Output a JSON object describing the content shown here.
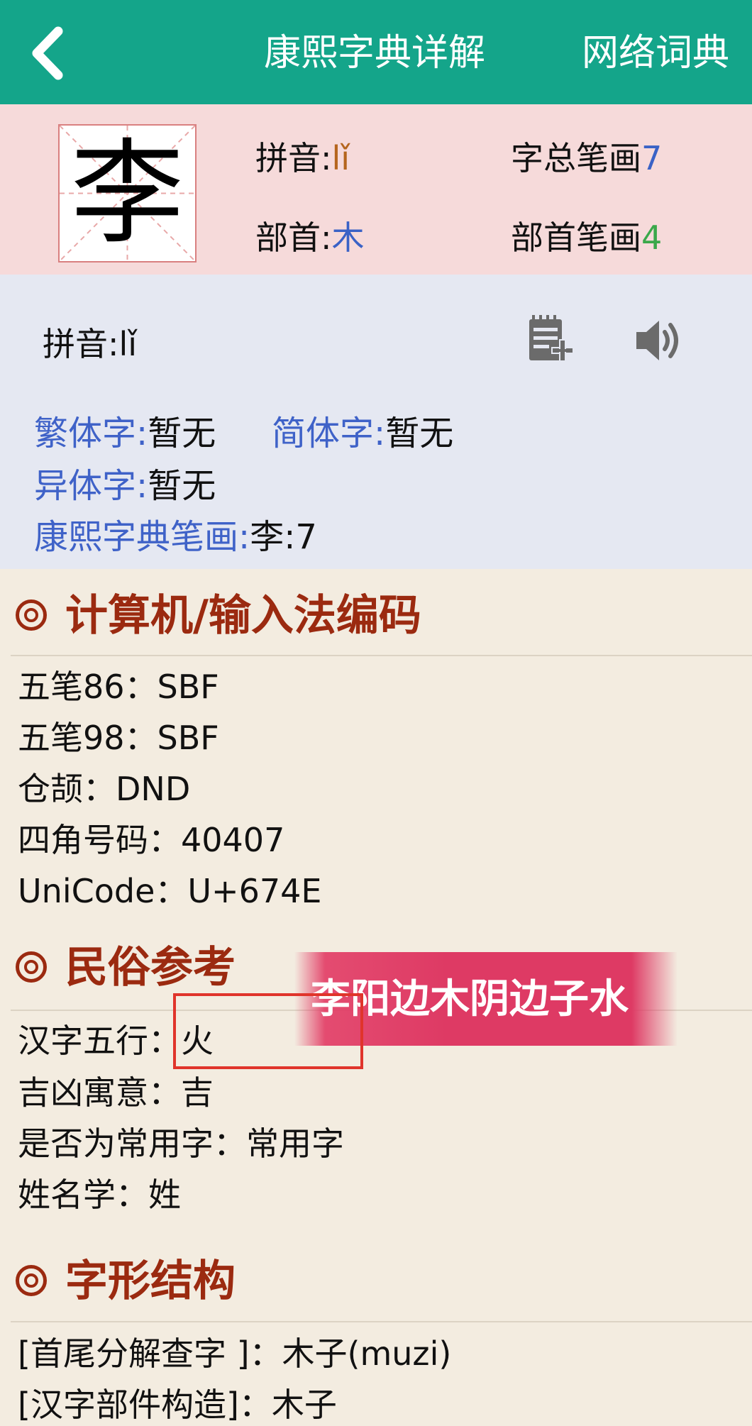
{
  "header": {
    "back_icon": "chevron-left-icon",
    "title": "康熙字典详解",
    "web_dict": "网络词典",
    "bg_color": "#14a58a"
  },
  "character": {
    "glyph": "李",
    "pinyin_label": "拼音:",
    "pinyin_value": "lǐ",
    "strokes_label": "字总笔画",
    "strokes_value": "7",
    "radical_label": "部首:",
    "radical_value": "木",
    "radical_strokes_label": "部首笔画",
    "radical_strokes_value": "4"
  },
  "pinyin_block": {
    "pinyin_label": "拼音:",
    "pinyin_value": "lǐ",
    "note_icon": "notepad-add-icon",
    "sound_icon": "speaker-icon",
    "traditional_label": "繁体字:",
    "traditional_value": "暂无",
    "simplified_label": "简体字:",
    "simplified_value": "暂无",
    "variant_label": "异体字:",
    "variant_value": "暂无",
    "kangxi_label": "康熙字典笔画:",
    "kangxi_value": "李:7"
  },
  "sections": {
    "computer": {
      "title": "计算机/输入法编码",
      "rows": [
        "五笔86：SBF",
        "五笔98：SBF",
        "仓颉：DND",
        "四角号码：40407",
        "UniCode：U+674E"
      ]
    },
    "folk": {
      "title": "民俗参考",
      "rows": [
        "汉字五行：火",
        "吉凶寓意：吉",
        "是否为常用字：常用字",
        "姓名学：姓"
      ]
    },
    "structure": {
      "title": "字形结构",
      "rows": [
        "[首尾分解查字 ]：木子(muzi)",
        "[汉字部件构造]：木子"
      ]
    }
  },
  "overlay": {
    "banner_text": "李阳边木阴边子水",
    "banner_color": "#de3a64",
    "highlight_color": "#e0342b"
  }
}
